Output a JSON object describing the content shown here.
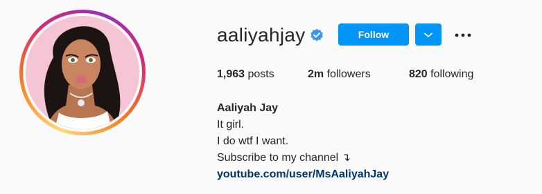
{
  "profile": {
    "username": "aaliyahjay",
    "verified": true,
    "follow_label": "Follow",
    "stats": {
      "posts_count": "1,963",
      "posts_label": " posts",
      "followers_count": "2m",
      "followers_label": " followers",
      "following_count": "820",
      "following_label": " following"
    },
    "bio": {
      "full_name": "Aaliyah Jay",
      "lines": [
        "It girl.",
        "I do wtf I want.",
        "Subscribe to my channel ↴"
      ],
      "link": "youtube.com/user/MsAaliyahJay"
    }
  },
  "colors": {
    "accent": "#0095f6",
    "link": "#00376b",
    "text": "#262626",
    "background": "#fafafa",
    "avatar_bg": "#f6c5d4"
  },
  "icons": {
    "verified": "verified-badge-icon",
    "dropdown": "chevron-down-icon",
    "more": "more-options-icon"
  }
}
